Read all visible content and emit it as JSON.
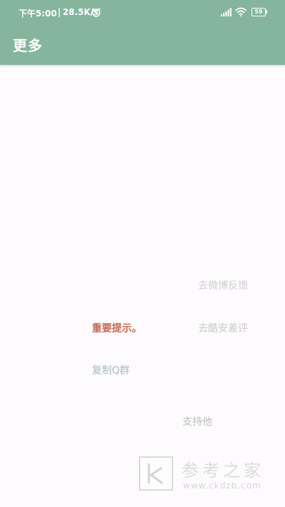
{
  "status_bar": {
    "time": "下午5:00",
    "separator": "|",
    "net_speed": "28.5K/s",
    "battery_level": "59",
    "icons": [
      "alarm-icon",
      "signal-icon",
      "wifi-icon",
      "battery-icon"
    ]
  },
  "toolbar": {
    "title": "更多"
  },
  "tags": {
    "weibo_feedback": "去微博反馈",
    "important_notice": "重要提示。",
    "coolapk_review": "去酷安差评",
    "copy_qq_group": "复制Q群",
    "support_him": "支持他"
  },
  "colors": {
    "appbar": "#86b59e",
    "background": "#fdfbfd",
    "tag_weibo": "#d0d0d0",
    "tag_important": "#c66a55",
    "tag_coolapk": "#c9c9c9",
    "tag_qq": "#a6bbc0",
    "tag_support": "#bdbdbd"
  },
  "watermark": {
    "brand": "参考之家",
    "url": "www.ckdzb.com",
    "logo_letter": "k"
  }
}
